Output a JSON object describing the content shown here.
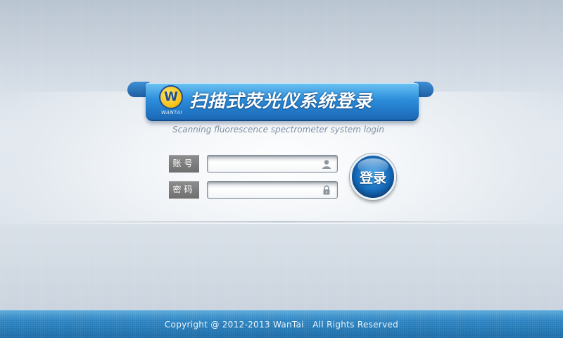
{
  "header": {
    "title": "扫描式荧光仪系统登录",
    "subtitle": "Scanning fluorescence spectrometer system login",
    "logo_letter": "W",
    "logo_text": "WANTAI"
  },
  "form": {
    "account_label": "账号",
    "account_value": "",
    "account_icon": "user-icon",
    "password_label": "密码",
    "password_value": "",
    "password_icon": "lock-icon",
    "login_label": "登录"
  },
  "footer": {
    "copyright": "Copyright @ 2012-2013 WanTai   All Rights Reserved"
  },
  "colors": {
    "ribbon": "#2c8edb",
    "footer": "#2a83c1",
    "button": "#1569b8",
    "logo_yellow": "#f5bf12"
  }
}
